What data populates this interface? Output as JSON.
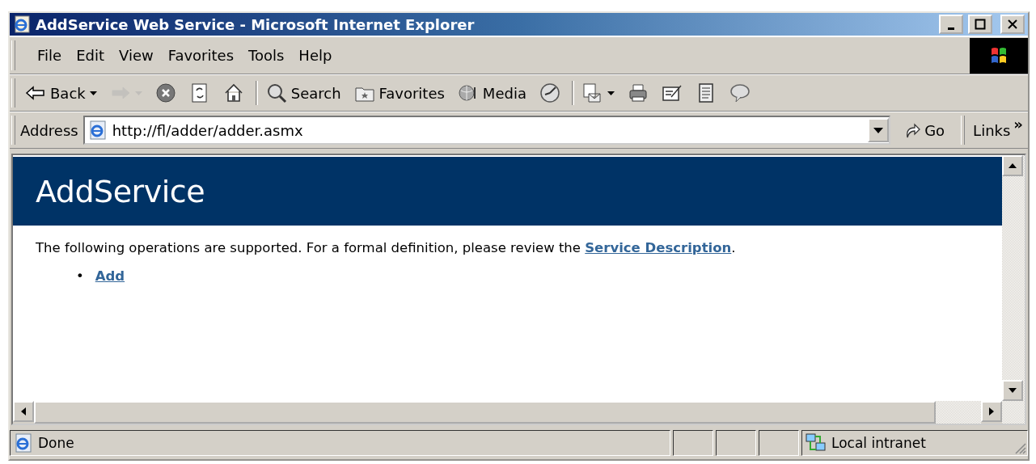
{
  "window": {
    "title": "AddService Web Service - Microsoft Internet Explorer"
  },
  "menu": [
    "File",
    "Edit",
    "View",
    "Favorites",
    "Tools",
    "Help"
  ],
  "toolbar": [
    {
      "kind": "back",
      "label": "Back",
      "disabled": false
    },
    {
      "kind": "forward",
      "disabled": true
    },
    {
      "kind": "stop",
      "disabled": false
    },
    {
      "kind": "refresh",
      "disabled": false
    },
    {
      "kind": "home",
      "disabled": false
    },
    {
      "kind": "search",
      "label": "Search",
      "disabled": false
    },
    {
      "kind": "favorites",
      "label": "Favorites",
      "disabled": false
    },
    {
      "kind": "media",
      "label": "Media",
      "disabled": false
    },
    {
      "kind": "history",
      "disabled": false
    },
    {
      "kind": "mail",
      "disabled": false
    },
    {
      "kind": "print",
      "disabled": false
    },
    {
      "kind": "edit",
      "disabled": false
    },
    {
      "kind": "discuss",
      "disabled": false
    },
    {
      "kind": "messenger",
      "disabled": false
    }
  ],
  "address": {
    "label": "Address",
    "value": "http://fl/adder/adder.asmx",
    "go": "Go",
    "links": "Links",
    "chevron": "»"
  },
  "page": {
    "heading": "AddService",
    "intro_before": "The following operations are supported. For a formal definition, please review the ",
    "link": "Service Description",
    "intro_after": ".",
    "operations": [
      {
        "bullet": "•",
        "label": "Add"
      }
    ]
  },
  "status_bar": {
    "text": "Done",
    "zone": "Local intranet"
  }
}
